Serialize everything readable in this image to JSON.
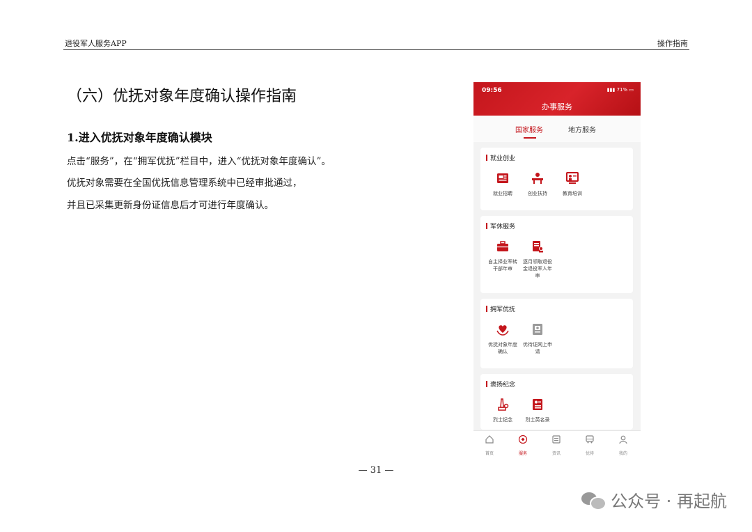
{
  "header": {
    "left": "退役军人服务APP",
    "right": "操作指南"
  },
  "title": "（六）优抚对象年度确认操作指南",
  "subtitle": "1.进入优抚对象年度确认模块",
  "paragraphs": [
    "点击“服务”，在“拥军优抚”栏目中，进入“优抚对象年度确认”。",
    "优抚对象需要在全国优抚信息管理系统中已经审批通过，",
    "并且已采集更新身份证信息后才可进行年度确认。"
  ],
  "page_number": "— 31 —",
  "watermark": "公众号 · 再起航",
  "phone": {
    "status_time": "09:56",
    "status_battery": "71%",
    "app_title": "办事服务",
    "tabs": [
      "国家服务",
      "地方服务"
    ],
    "sections": [
      {
        "title": "就业创业",
        "items": [
          "就业招聘",
          "创业扶持",
          "教育培训"
        ]
      },
      {
        "title": "军休服务",
        "items": [
          "自主择业军转干部年审",
          "逐月领取退役金退役军人年审"
        ]
      },
      {
        "title": "拥军优抚",
        "items": [
          "优抚对象年度确认",
          "优待证网上申请"
        ]
      },
      {
        "title": "褒扬纪念",
        "items": [
          "烈士纪念",
          "烈士英名录"
        ]
      }
    ],
    "bottom_nav": [
      "首页",
      "服务",
      "资讯",
      "优待",
      "我的"
    ],
    "colors": {
      "brand": "#c4161c"
    }
  }
}
